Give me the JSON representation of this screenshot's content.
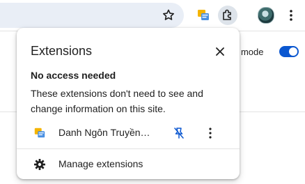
{
  "toolbar": {
    "icons": [
      "star-icon",
      "extension-icon",
      "extensions-puzzle-icon",
      "profile-avatar",
      "more-vert-icon"
    ]
  },
  "page": {
    "partial_label": "r mode",
    "toggle_state": "on"
  },
  "popup": {
    "title": "Extensions",
    "section_heading": "No access needed",
    "section_description": "These extensions don't need to see and change information on this site.",
    "extensions": [
      {
        "name": "Danh Ngôn Truyền…",
        "icon": "extension-icon",
        "pinned": false
      }
    ],
    "manage_label": "Manage extensions"
  },
  "colors": {
    "accent": "#0b57d0",
    "omnibox_bg": "#e9eef6",
    "active_button_bg": "#dde3ea",
    "text": "#1f1f1f"
  }
}
